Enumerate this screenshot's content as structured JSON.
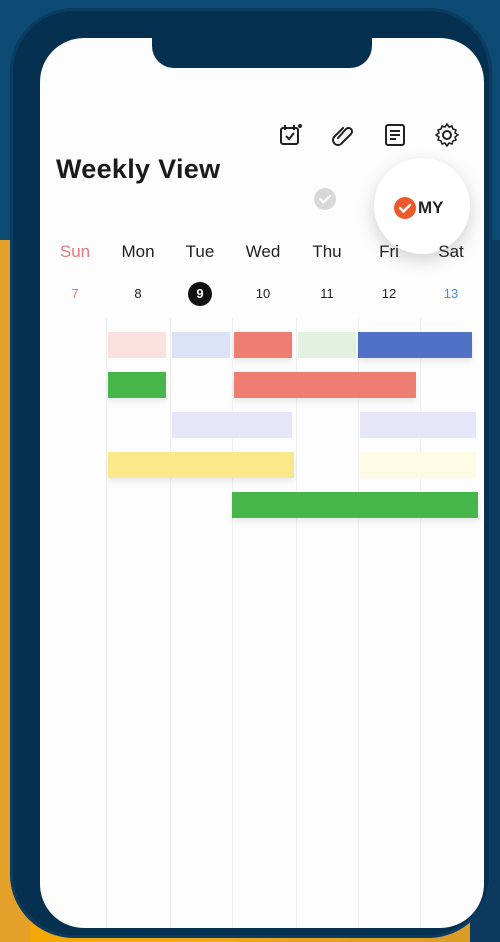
{
  "app": {
    "title": "Weekly View"
  },
  "toolbar": {
    "icons": [
      "calendar-add-icon",
      "paperclip-icon",
      "notes-icon",
      "gear-icon"
    ]
  },
  "filter": {
    "my_label": "MY"
  },
  "week": {
    "days": [
      {
        "name": "Sun",
        "date": "7"
      },
      {
        "name": "Mon",
        "date": "8"
      },
      {
        "name": "Tue",
        "date": "9",
        "today": true
      },
      {
        "name": "Wed",
        "date": "10"
      },
      {
        "name": "Thu",
        "date": "11"
      },
      {
        "name": "Fri",
        "date": "12"
      },
      {
        "name": "Sat",
        "date": "13"
      }
    ]
  },
  "colors": {
    "sunday": "#e07a7a",
    "saturday": "#4a8fd6",
    "accent": "#ec5a2c",
    "event_pink_light": "#fbe2e0",
    "event_lavender": "#dde3f6",
    "event_salmon": "#ee7d72",
    "event_mint": "#e3f1e0",
    "event_blue": "#4f72c6",
    "event_green": "#46b64a",
    "event_lavender_light": "#e5e6f7",
    "event_yellow": "#f9e98a",
    "event_yellow_light": "#fdfbe4"
  }
}
